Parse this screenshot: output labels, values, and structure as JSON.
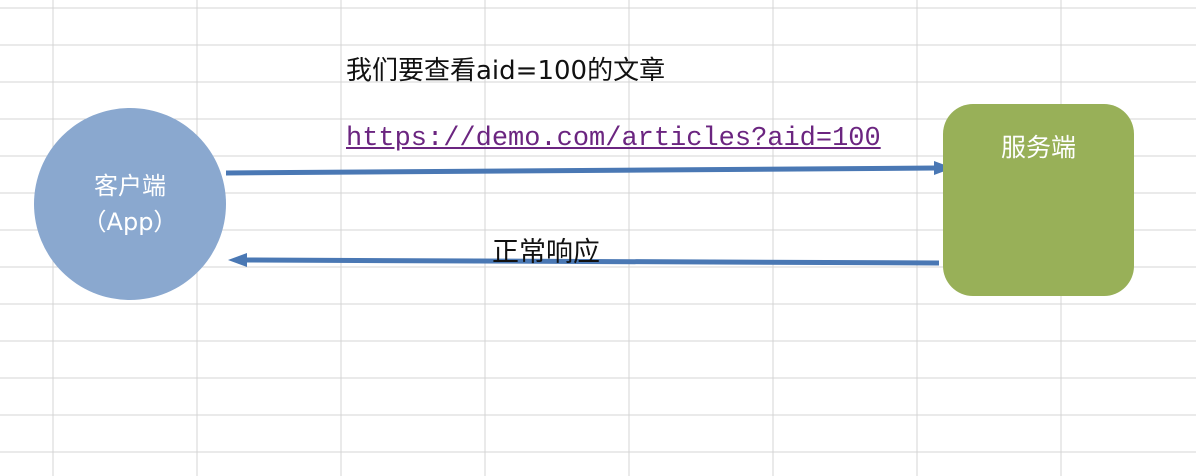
{
  "diagram": {
    "client": {
      "line1": "客户端",
      "line2": "（App）"
    },
    "server": {
      "label": "服务端"
    },
    "request": {
      "caption": "我们要查看aid=100的文章",
      "url": "https://demo.com/articles?aid=100"
    },
    "response": {
      "caption": "正常响应"
    }
  },
  "colors": {
    "client_fill": "#8aa8cf",
    "server_fill": "#98b058",
    "arrow": "#4a78b4",
    "url_text": "#6b2580",
    "gridline": "#d4d4d4"
  }
}
